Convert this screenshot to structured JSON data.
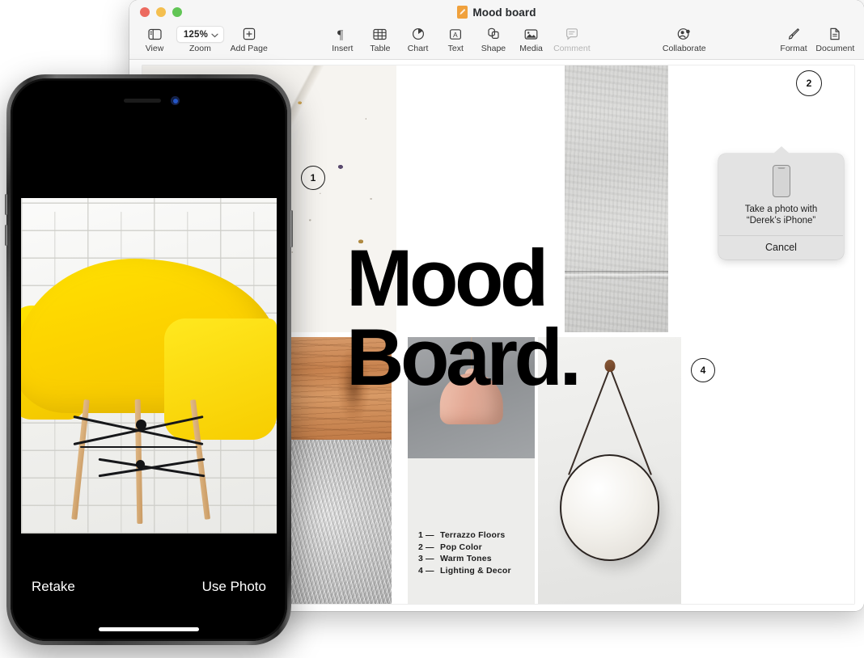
{
  "window": {
    "title": "Mood board",
    "doc_icon": "pages-document-icon",
    "traffic_lights": [
      "close-button",
      "minimize-button",
      "zoom-button"
    ],
    "colors": {
      "close": "#ec6a5f",
      "minimize": "#f4bf4f",
      "maximize": "#61c555",
      "toolbar_bg": "#f6f6f6",
      "accent_orange": "#f0a13c"
    }
  },
  "toolbar": {
    "items": [
      {
        "id": "view",
        "label": "View",
        "icon": "sidebar-icon",
        "enabled": true
      },
      {
        "id": "zoom",
        "label": "Zoom",
        "icon": "chevron-down-icon",
        "value": "125%",
        "enabled": true
      },
      {
        "id": "add-page",
        "label": "Add Page",
        "icon": "plus-square-icon",
        "enabled": true
      },
      {
        "id": "insert",
        "label": "Insert",
        "icon": "pilcrow-icon",
        "enabled": true
      },
      {
        "id": "table",
        "label": "Table",
        "icon": "table-grid-icon",
        "enabled": true
      },
      {
        "id": "chart",
        "label": "Chart",
        "icon": "pie-chart-icon",
        "enabled": true
      },
      {
        "id": "text",
        "label": "Text",
        "icon": "text-box-icon",
        "enabled": true
      },
      {
        "id": "shape",
        "label": "Shape",
        "icon": "shapes-icon",
        "enabled": true
      },
      {
        "id": "media",
        "label": "Media",
        "icon": "photo-icon",
        "enabled": true
      },
      {
        "id": "comment",
        "label": "Comment",
        "icon": "comment-bubble-icon",
        "enabled": false
      },
      {
        "id": "collaborate",
        "label": "Collaborate",
        "icon": "collaborate-person-icon",
        "enabled": true
      },
      {
        "id": "format",
        "label": "Format",
        "icon": "paintbrush-icon",
        "enabled": true
      },
      {
        "id": "document",
        "label": "Document",
        "icon": "document-page-icon",
        "enabled": true
      }
    ]
  },
  "document": {
    "title_line1": "Mood",
    "title_line2": "Board.",
    "legend": [
      {
        "num": "1",
        "dash": "—",
        "label": "Terrazzo Floors"
      },
      {
        "num": "2",
        "dash": "—",
        "label": "Pop Color"
      },
      {
        "num": "3",
        "dash": "—",
        "label": "Warm Tones"
      },
      {
        "num": "4",
        "dash": "—",
        "label": "Lighting & Decor"
      }
    ],
    "badges": [
      {
        "id": "badge-1",
        "label": "1"
      },
      {
        "id": "badge-2",
        "label": "2"
      },
      {
        "id": "badge-4",
        "label": "4"
      }
    ],
    "images": [
      {
        "id": "terrazzo-slab",
        "alt": "Terrazzo slab texture"
      },
      {
        "id": "concrete-wall",
        "alt": "Concrete wall texture"
      },
      {
        "id": "plaster-sofa",
        "alt": "Tan leather sofa against plaster wall"
      },
      {
        "id": "wood-grain",
        "alt": "Warm wood grain"
      },
      {
        "id": "grey-fur",
        "alt": "Grey faux fur rug"
      },
      {
        "id": "pendant-lamp",
        "alt": "Blush pendant lamp"
      },
      {
        "id": "round-mirror",
        "alt": "Round strap mirror"
      }
    ]
  },
  "popover": {
    "line1": "Take a photo with",
    "line2": "“Derek’s iPhone”",
    "cancel_label": "Cancel",
    "icon": "iphone-icon"
  },
  "iphone": {
    "device": "iPhone",
    "photo_alt": "Yellow molded plastic armchair with wood dowel legs against white brick wall",
    "retake_label": "Retake",
    "use_photo_label": "Use Photo",
    "home_indicator": "home-indicator"
  }
}
